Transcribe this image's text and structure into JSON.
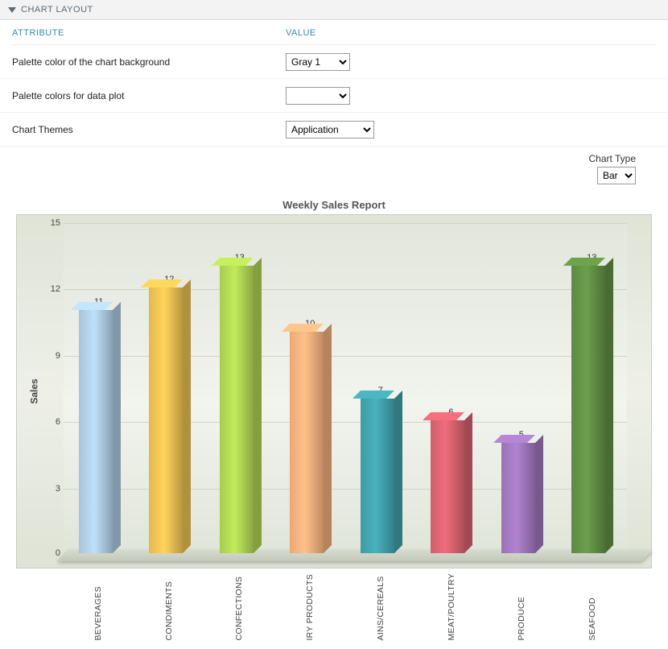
{
  "section_title": "CHART LAYOUT",
  "columns": {
    "attr": "ATTRIBUTE",
    "val": "VALUE"
  },
  "rows": {
    "bg": {
      "label": "Palette color of the chart background",
      "value": "Gray 1"
    },
    "plot": {
      "label": "Palette colors for data plot",
      "value": ""
    },
    "theme": {
      "label": "Chart Themes",
      "value": "Application"
    }
  },
  "chart_type": {
    "label": "Chart Type",
    "value": "Bar"
  },
  "chart_data": {
    "type": "bar",
    "title": "Weekly Sales Report",
    "ylabel": "Sales",
    "ylim": [
      0,
      15
    ],
    "yticks": [
      0,
      3,
      6,
      9,
      12,
      15
    ],
    "categories": [
      "BEVERAGES",
      "CONDIMENTS",
      "CONFECTIONS",
      "DAIRY PRODUCTS",
      "GRAINS/CEREALS",
      "MEAT/POULTRY",
      "PRODUCE",
      "SEAFOOD"
    ],
    "x_display": [
      "BEVERAGES",
      "CONDIMENTS",
      "CONFECTIONS",
      "IRY PRODUCTS",
      "AINS/CEREALS",
      "MEAT/POULTRY",
      "PRODUCE",
      "SEAFOOD"
    ],
    "values": [
      11,
      12,
      13,
      10,
      7,
      6,
      5,
      13
    ],
    "colors": [
      "#a6c3da",
      "#e3b84f",
      "#a8cc4f",
      "#eaa877",
      "#3f9ba5",
      "#cf5f6b",
      "#9a72b6",
      "#5d8a42"
    ]
  }
}
